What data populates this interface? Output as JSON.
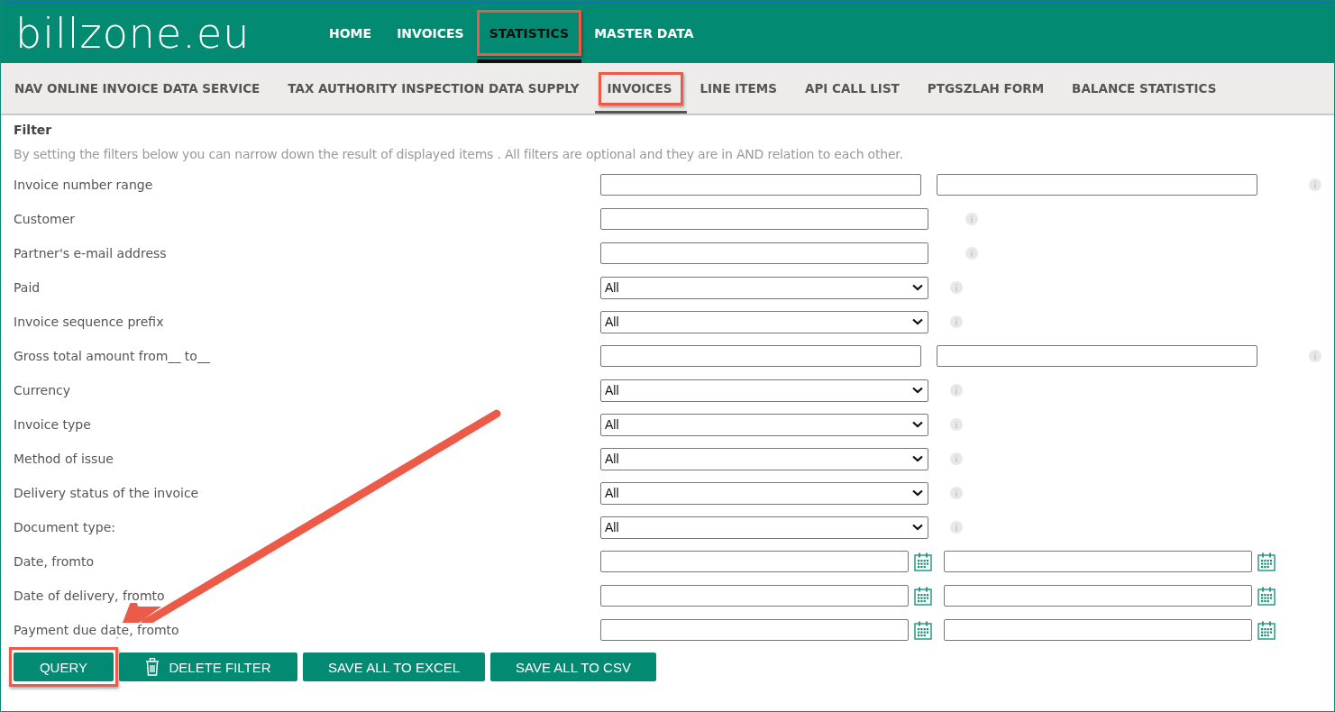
{
  "logo": "billzone.eu",
  "main_nav": [
    {
      "label": "HOME",
      "selected": false,
      "annotated": false
    },
    {
      "label": "INVOICES",
      "selected": false,
      "annotated": false
    },
    {
      "label": "STATISTICS",
      "selected": true,
      "annotated": true
    },
    {
      "label": "MASTER DATA",
      "selected": false,
      "annotated": false
    }
  ],
  "sub_nav": [
    {
      "label": "NAV ONLINE INVOICE DATA SERVICE",
      "selected": false,
      "annotated": false
    },
    {
      "label": "TAX AUTHORITY INSPECTION DATA SUPPLY",
      "selected": false,
      "annotated": false
    },
    {
      "label": "INVOICES",
      "selected": true,
      "annotated": true
    },
    {
      "label": "LINE ITEMS",
      "selected": false,
      "annotated": false
    },
    {
      "label": "API CALL LIST",
      "selected": false,
      "annotated": false
    },
    {
      "label": "PTGSZLAH FORM",
      "selected": false,
      "annotated": false
    },
    {
      "label": "BALANCE STATISTICS",
      "selected": false,
      "annotated": false
    }
  ],
  "filter": {
    "title": "Filter",
    "description": "By setting the filters below you can narrow down the result of displayed items . All filters are optional and they are in AND relation to each other.",
    "rows": [
      {
        "kind": "range",
        "label": "Invoice number range"
      },
      {
        "kind": "text",
        "label": "Customer"
      },
      {
        "kind": "text",
        "label": "Partner's e-mail address"
      },
      {
        "kind": "select",
        "label": "Paid",
        "value": "All"
      },
      {
        "kind": "select",
        "label": "Invoice sequence prefix",
        "value": "All"
      },
      {
        "kind": "range",
        "label": "Gross total amount from__ to__"
      },
      {
        "kind": "select",
        "label": "Currency",
        "value": "All"
      },
      {
        "kind": "select",
        "label": "Invoice type",
        "value": "All"
      },
      {
        "kind": "select",
        "label": "Method of issue",
        "value": "All"
      },
      {
        "kind": "select",
        "label": "Delivery status of the invoice",
        "value": "All"
      },
      {
        "kind": "select",
        "label": "Document type:",
        "value": "All"
      },
      {
        "kind": "date",
        "label": "Date, fromto"
      },
      {
        "kind": "date",
        "label": "Date of delivery, fromto"
      },
      {
        "kind": "date",
        "label": "Payment due date, fromto"
      }
    ]
  },
  "buttons": [
    {
      "label": "QUERY",
      "kind": "plain",
      "annotated": true
    },
    {
      "label": "DELETE FILTER",
      "kind": "trash",
      "annotated": false
    },
    {
      "label": "SAVE ALL TO EXCEL",
      "kind": "plain",
      "annotated": false
    },
    {
      "label": "SAVE ALL TO CSV",
      "kind": "plain",
      "annotated": false
    }
  ],
  "annotation_arrow": true
}
